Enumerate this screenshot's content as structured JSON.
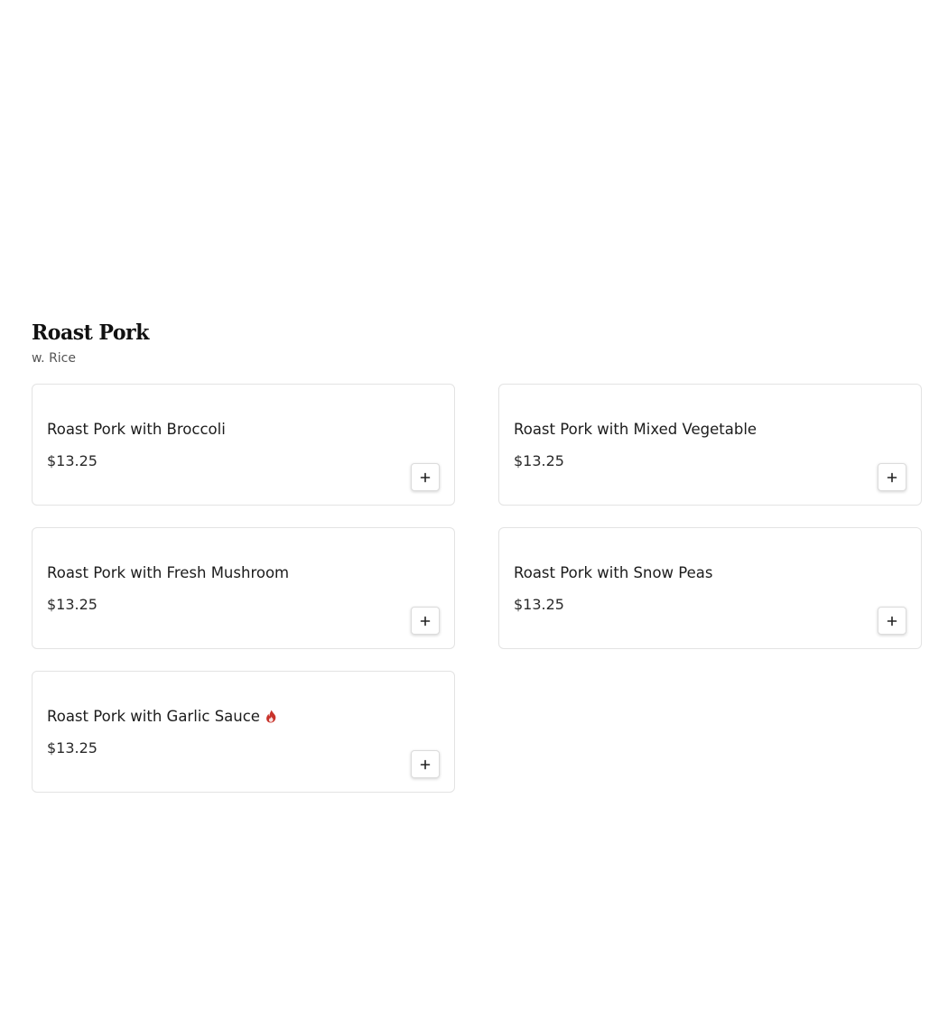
{
  "section": {
    "title": "Roast Pork",
    "subtitle": "w. Rice"
  },
  "items": [
    {
      "name": "Roast Pork with Broccoli",
      "price": "$13.25",
      "spicy": false,
      "add_icon": "plus-icon"
    },
    {
      "name": "Roast Pork with Mixed Vegetable",
      "price": "$13.25",
      "spicy": false,
      "add_icon": "plus-icon"
    },
    {
      "name": "Roast Pork with Fresh Mushroom",
      "price": "$13.25",
      "spicy": false,
      "add_icon": "plus-icon"
    },
    {
      "name": "Roast Pork with Snow Peas",
      "price": "$13.25",
      "spicy": false,
      "add_icon": "plus-icon"
    },
    {
      "name": "Roast Pork with Garlic Sauce",
      "price": "$13.25",
      "spicy": true,
      "spicy_icon": "flame-icon",
      "add_icon": "plus-icon"
    }
  ],
  "colors": {
    "spicy": "#c8332b",
    "card_border": "#e3e3e3",
    "text": "#1c1c1c"
  }
}
